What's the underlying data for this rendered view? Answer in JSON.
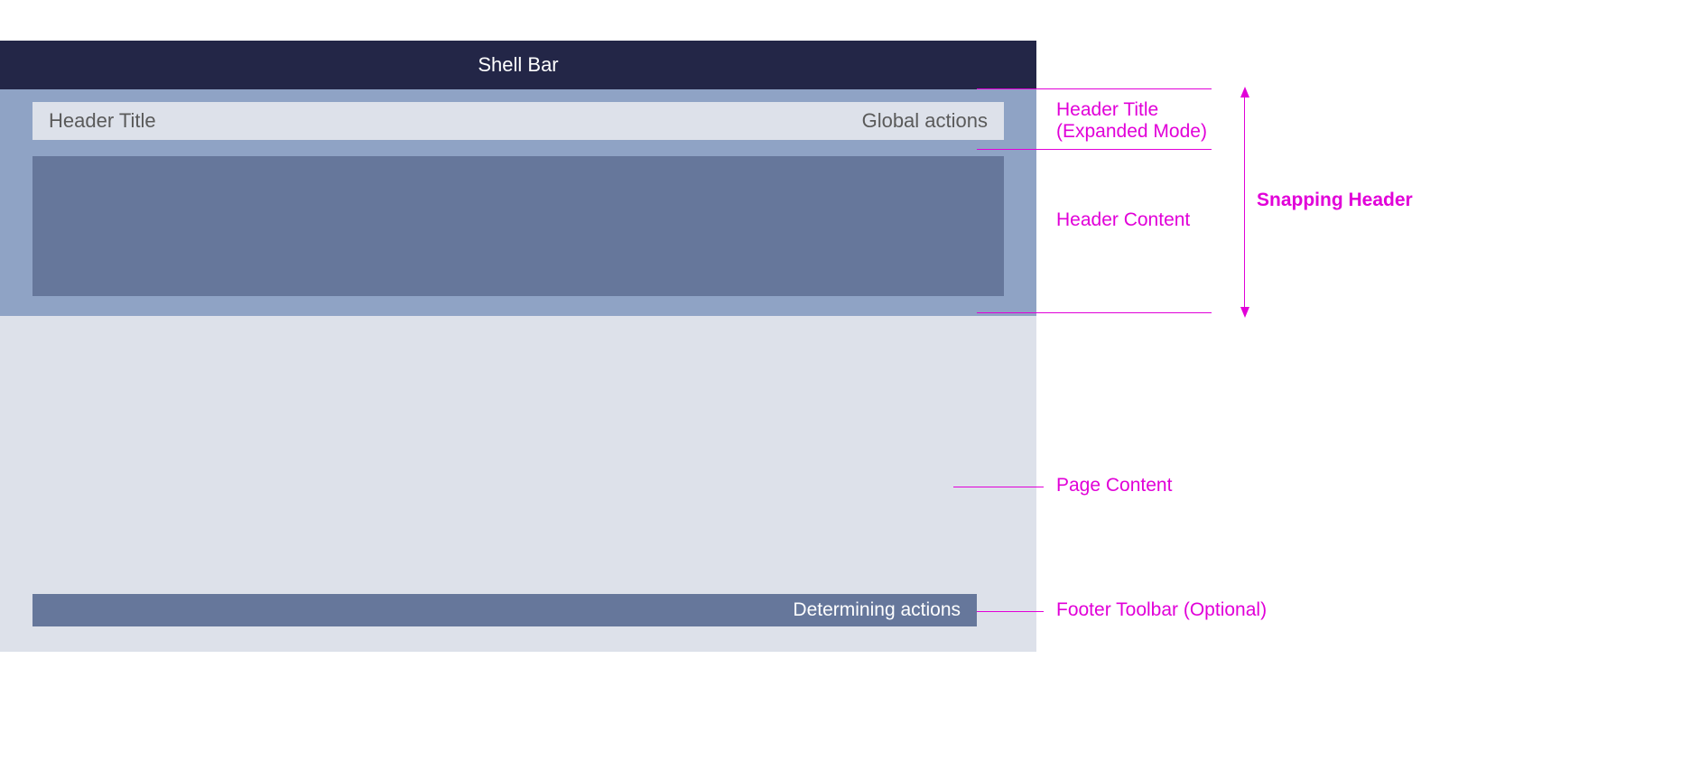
{
  "shell_bar": {
    "label": "Shell Bar"
  },
  "header": {
    "title_label": "Header Title",
    "global_actions_label": "Global actions"
  },
  "footer": {
    "actions_label": "Determining actions"
  },
  "annotations": {
    "header_title_expanded": {
      "line1": "Header Title",
      "line2": "(Expanded Mode)"
    },
    "header_content": "Header Content",
    "snapping_header": "Snapping Header",
    "page_content": "Page Content",
    "footer_toolbar": "Footer Toolbar (Optional)"
  }
}
